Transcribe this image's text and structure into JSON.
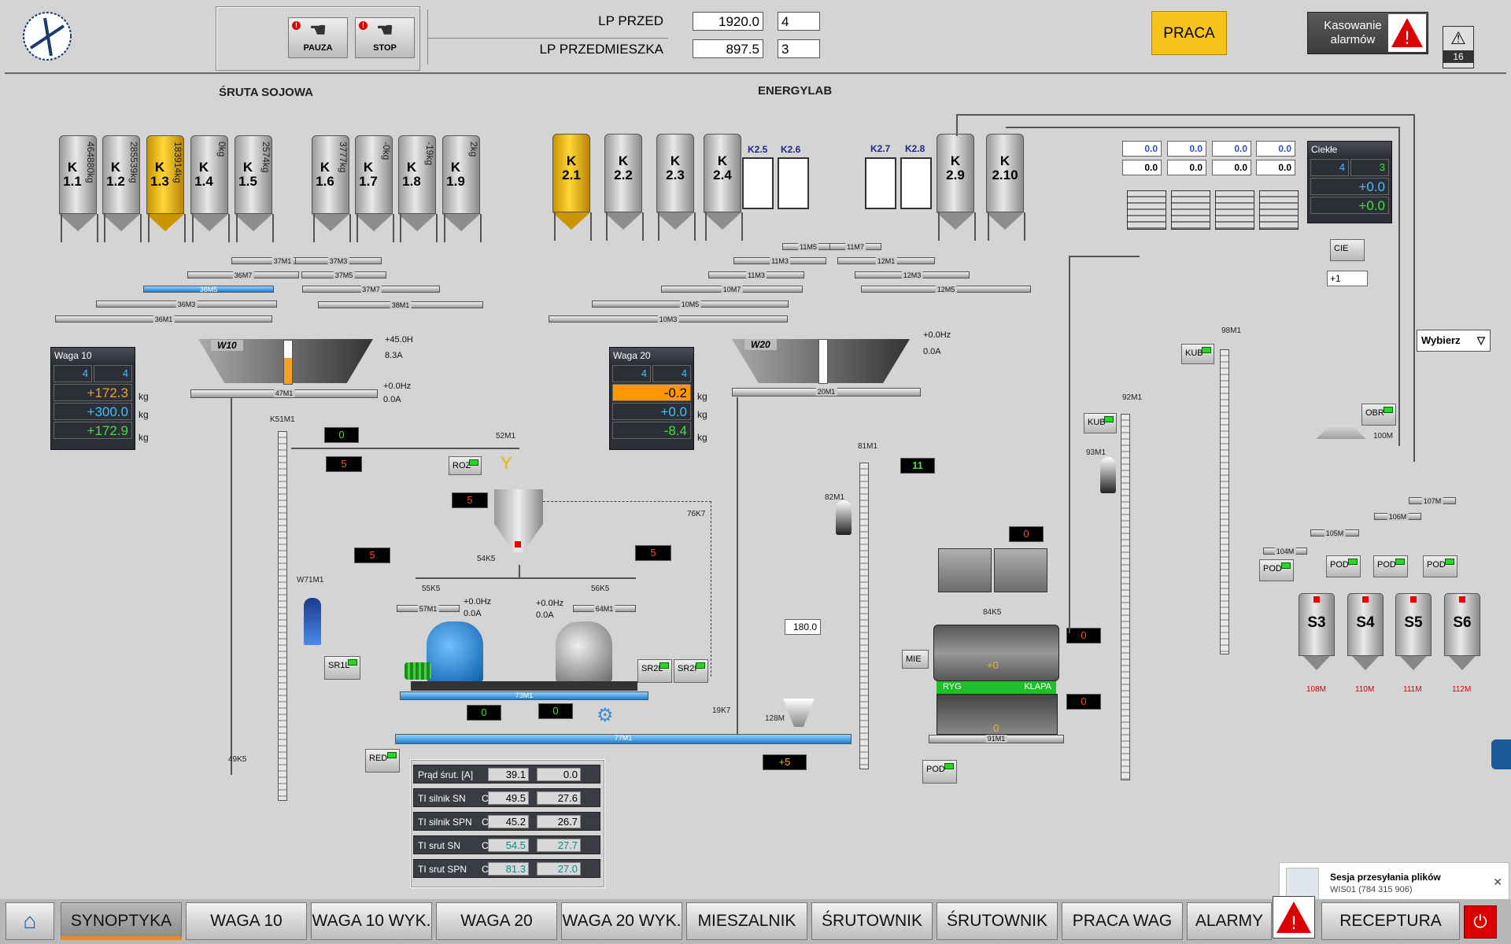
{
  "header": {
    "pauza_label": "PAUZA",
    "stop_label": "STOP",
    "lp_przed_label": "LP PRZED",
    "lp_przed_value": "1920.0",
    "lp_przed_count": "4",
    "lp_przedmieszka_label": "LP PRZEDMIESZKA",
    "lp_przedmieszka_value": "897.5",
    "lp_przedmieszka_count": "3",
    "praca_label": "PRACA",
    "kasowanie_label_1": "Kasowanie",
    "kasowanie_label_2": "alarmów",
    "alarm_count": "16",
    "accent_yellow": "#f7c21a"
  },
  "sections": {
    "sruta": "ŚRUTA SOJOWA",
    "energylab": "ENERGYLAB"
  },
  "silos_left": [
    {
      "name": "K\n1.1",
      "weight": "464880kg",
      "active": false
    },
    {
      "name": "K\n1.2",
      "weight": "285539kg",
      "active": false
    },
    {
      "name": "K\n1.3",
      "weight": "183914kg",
      "active": true
    },
    {
      "name": "K\n1.4",
      "weight": "0kg",
      "active": false
    },
    {
      "name": "K\n1.5",
      "weight": "2574kg",
      "active": false
    },
    {
      "name": "K\n1.6",
      "weight": "3777kg",
      "active": false
    },
    {
      "name": "K\n1.7",
      "weight": "-0kg",
      "active": false
    },
    {
      "name": "K\n1.8",
      "weight": "-19kg",
      "active": false
    },
    {
      "name": "K\n1.9",
      "weight": "2kg",
      "active": false
    }
  ],
  "silos_right": [
    {
      "name": "K\n2.1",
      "active": true
    },
    {
      "name": "K\n2.2",
      "active": false
    },
    {
      "name": "K\n2.3",
      "active": false
    },
    {
      "name": "K\n2.4",
      "active": false
    },
    {
      "name": "K\n2.9",
      "active": false
    },
    {
      "name": "K\n2.10",
      "active": false
    }
  ],
  "bigbags": [
    "K2.5",
    "K2.6",
    "K2.7",
    "K2.8"
  ],
  "conveyors_left": [
    "37M1",
    "37M3",
    "36M7",
    "37M5",
    "36M5",
    "37M7",
    "36M3",
    "38M1",
    "36M1",
    "47M1"
  ],
  "conveyors_right": [
    "11M5",
    "11M7",
    "11M3",
    "12M1",
    "11M3",
    "12M3",
    "10M7",
    "12M5",
    "10M5",
    "10M3",
    "20M1"
  ],
  "scale_left": {
    "label": "W10",
    "hz1": "+45.0H",
    "amp1": "8.3A",
    "hz2": "+0.0Hz",
    "amp2": "0.0A",
    "panel_title": "Waga 10",
    "count_a": "4",
    "count_b": "4",
    "v1": "+172.3",
    "v2": "+300.0",
    "v3": "+172.9",
    "unit": "kg"
  },
  "scale_right": {
    "label": "W20",
    "hz": "+0.0Hz",
    "amp": "0.0A",
    "panel_title": "Waga 20",
    "count_a": "4",
    "count_b": "4",
    "v1": "-0.2",
    "v2": "+0.0",
    "v3": "-8.4",
    "unit": "kg"
  },
  "tags": {
    "k51m1": "K51M1",
    "m52": "52M1",
    "k76": "76K7",
    "k54": "54K5",
    "k55": "55K5",
    "k56": "56K5",
    "m57": "57M1",
    "m64": "64M1",
    "w71": "W71M1",
    "m73": "73M1",
    "m77": "77M1",
    "k49": "49K5",
    "k19": "19K7",
    "m128": "128M",
    "m81": "81M1",
    "m82": "82M1",
    "k84": "84K5",
    "m91": "91M1",
    "m92": "92M1",
    "m93": "93M1",
    "m98": "98M1",
    "m100": "100M",
    "m104": "104M",
    "m105": "105M",
    "m106": "106M",
    "m107": "107M",
    "m108": "108M",
    "m110": "110M",
    "m111": "111M",
    "m112": "112M"
  },
  "counters": {
    "c_0a": "0",
    "c_5a": "5",
    "c_5b": "5",
    "c_5c": "5",
    "c_5d": "5",
    "c_0b": "0",
    "c_0c": "0",
    "c_11": "11",
    "c_0d": "0",
    "c_0e": "0",
    "c_0f": "0",
    "c_plus5": "+5"
  },
  "mill": {
    "hz_l": "+0.0Hz",
    "amp_l": "0.0A",
    "hz_r": "+0.0Hz",
    "amp_r": "0.0A"
  },
  "buttons": {
    "roz": "ROZ",
    "sr1l": "SR1L",
    "sr2l": "SR2L",
    "sr2p": "SR2P",
    "red": "RED",
    "pod_mixer": "POD",
    "kub1": "KUB",
    "kub2": "KUB",
    "obr": "OBR",
    "cie": "CIE",
    "pod1": "POD",
    "pod2": "POD",
    "pod3": "POD",
    "pod4": "POD",
    "mie": "MIE",
    "wybierz": "Wybierz"
  },
  "mixer": {
    "value_box": "180.0",
    "ryg": "RYG",
    "klapa": "KLAPA",
    "top_value": "+0",
    "bottom_value": "0"
  },
  "liquid": {
    "title": "Ciekłe",
    "count_a": "4",
    "count_b": "3",
    "v1": "+0.0",
    "v2": "+0.0",
    "inputs_top": [
      "0.0",
      "0.0",
      "0.0",
      "0.0"
    ],
    "inputs_bottom": [
      "0.0",
      "0.0",
      "0.0",
      "0.0"
    ],
    "plus_one": "+1"
  },
  "tanks": [
    "S3",
    "S4",
    "S5",
    "S6"
  ],
  "readouts": [
    {
      "name": "Prąd śrut. [A]",
      "unit": "",
      "a": "39.1",
      "b": "0.0"
    },
    {
      "name": "TI silnik SN",
      "unit": "C",
      "a": "49.5",
      "b": "27.6"
    },
    {
      "name": "TI silnik SPN",
      "unit": "C",
      "a": "45.2",
      "b": "26.7"
    },
    {
      "name": "TI srut SN",
      "unit": "C",
      "a": "54.5",
      "b": "27.7"
    },
    {
      "name": "TI srut SPN",
      "unit": "C",
      "a": "81.3",
      "b": "27.0"
    }
  ],
  "nav": [
    "SYNOPTYKA",
    "WAGA 10",
    "WAGA 10 WYK.",
    "WAGA 20",
    "WAGA 20 WYK.",
    "MIESZALNIK",
    "ŚRUTOWNIK",
    "ŚRUTOWNIK",
    "PRACA WAG",
    "ALARMY",
    "RECEPTURA"
  ],
  "notification": {
    "title": "Sesja przesyłania plików",
    "subtitle": "WIS01 (784 315 906)"
  }
}
